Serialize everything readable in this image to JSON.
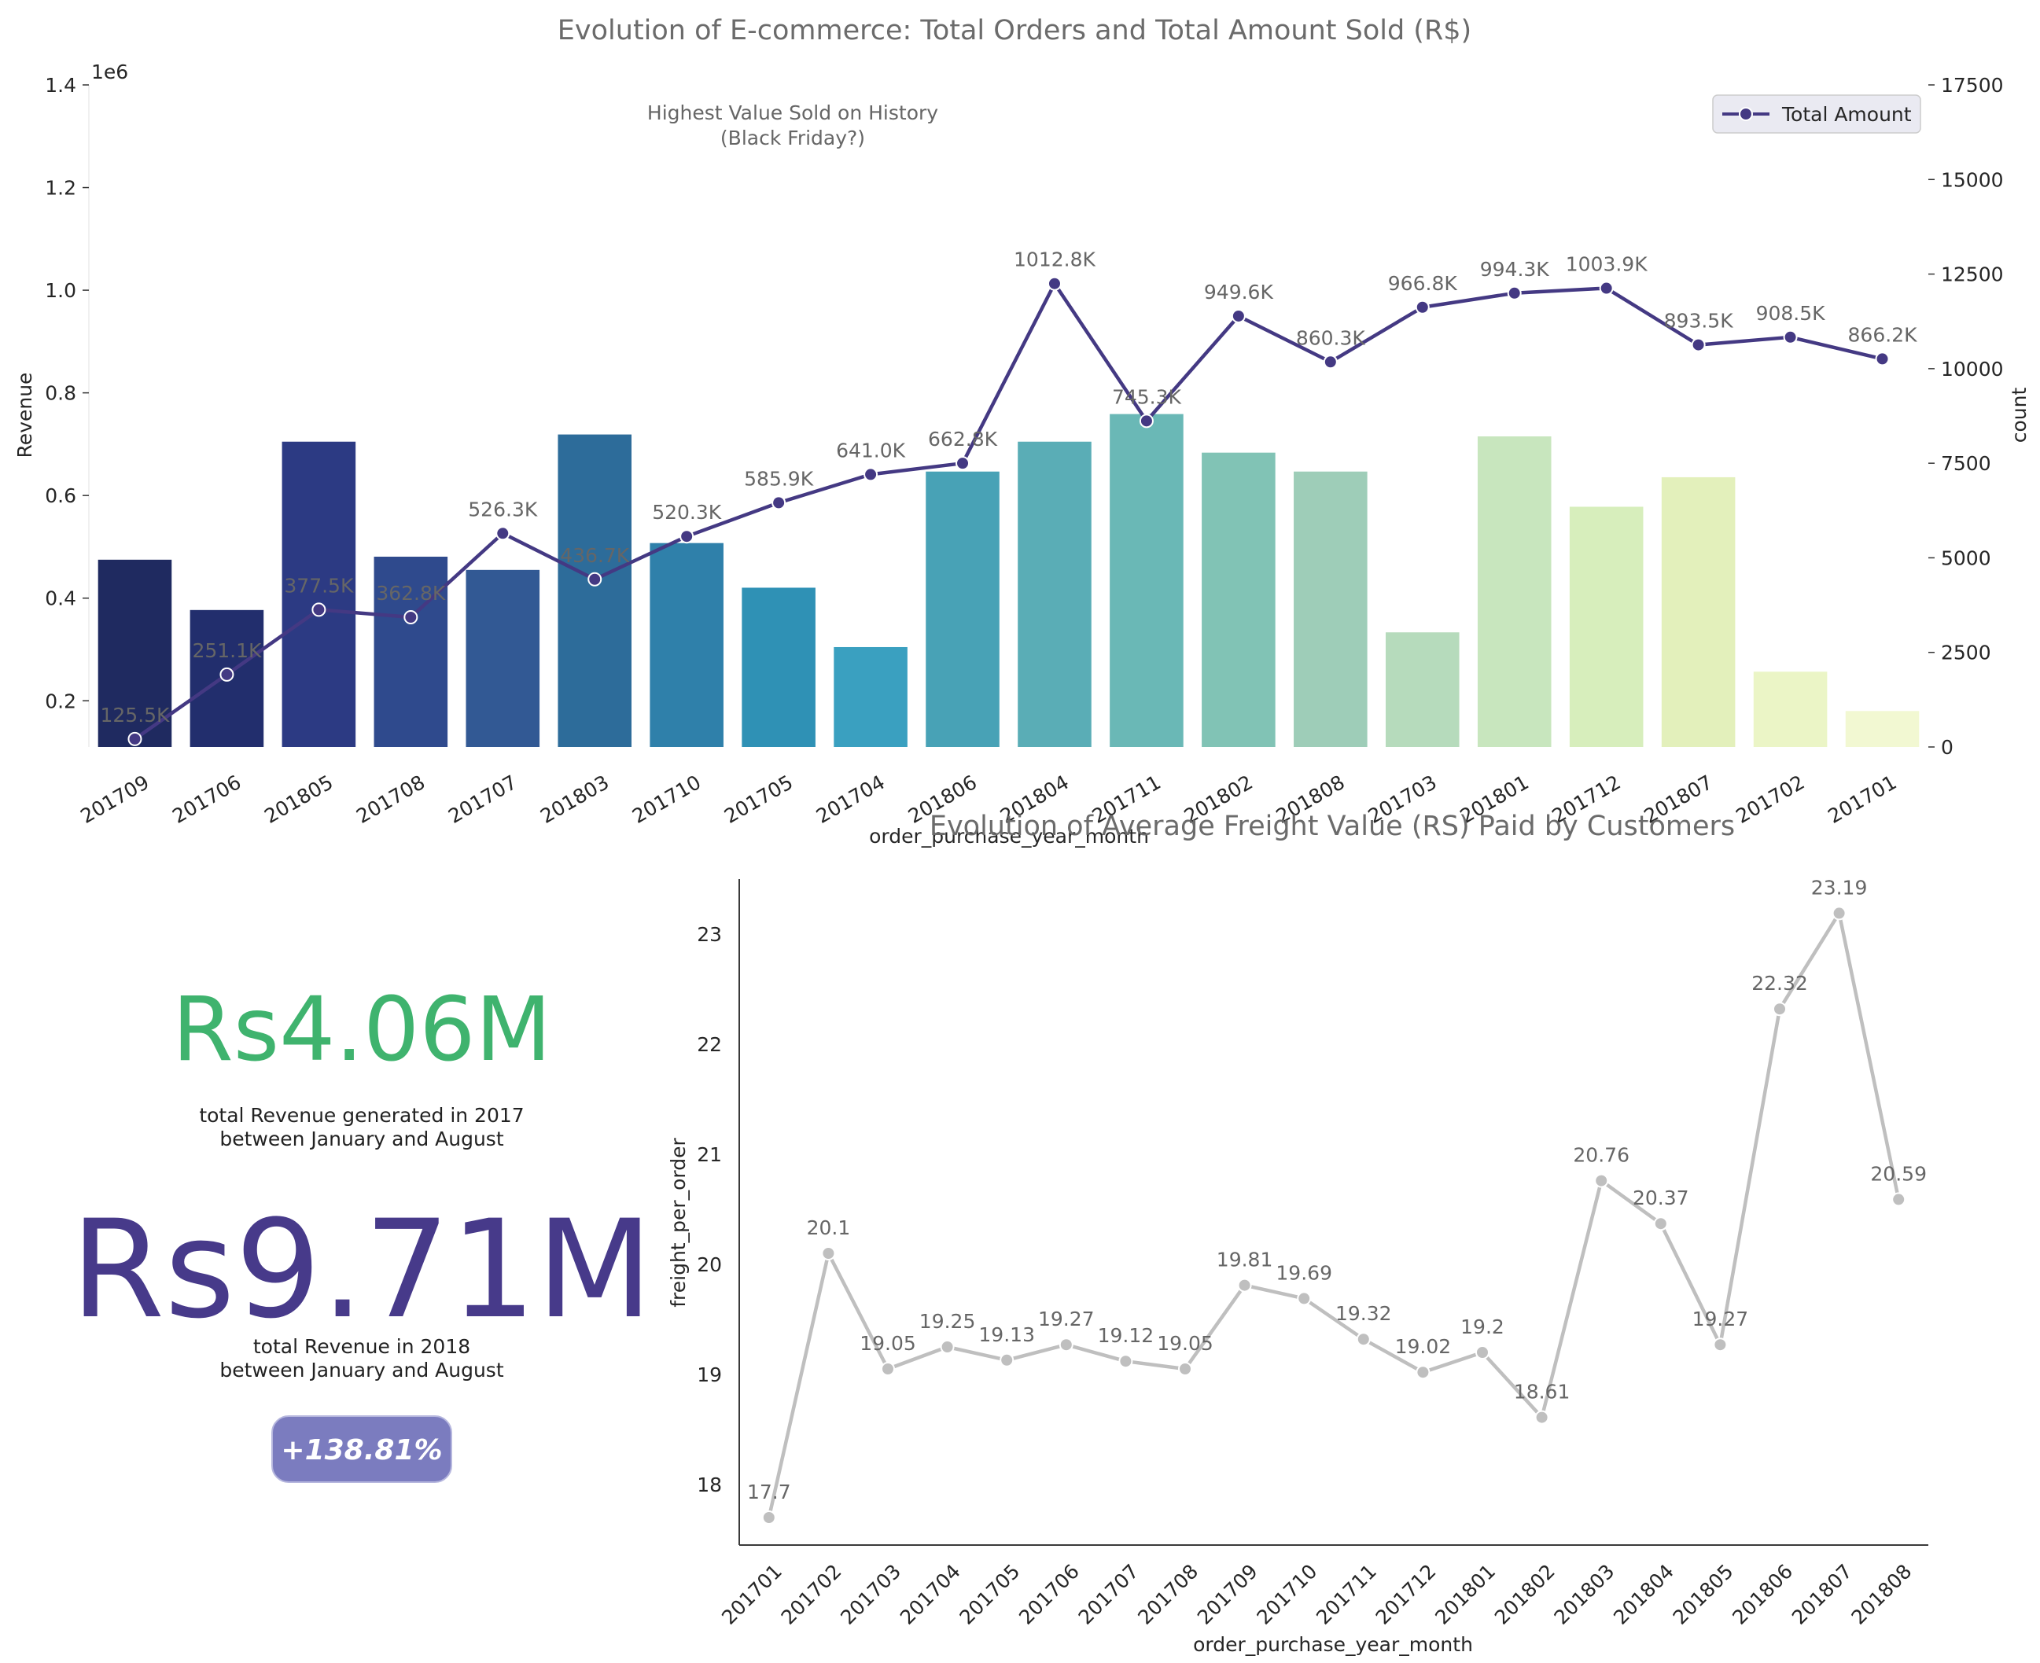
{
  "colors": {
    "line_main": "#443983",
    "freight_line": "#bfbfbf",
    "kpi_green": "#3fb36e",
    "kpi_purple": "#473a8a",
    "badge_bg": "#7b7cbf",
    "annotation_text": "#666666",
    "title_text": "#6b6b6b"
  },
  "chart_data": [
    {
      "type": "bar",
      "title": "Evolution of E-commerce: Total Orders and Total Amount Sold (R$)",
      "xlabel": "order_purchase_year_month",
      "ylabel": "Revenue",
      "y2label": "count",
      "y_multiplier": "1e6",
      "categories": [
        "201709",
        "201706",
        "201805",
        "201708",
        "201707",
        "201803",
        "201710",
        "201705",
        "201704",
        "201806",
        "201804",
        "201711",
        "201802",
        "201808",
        "201703",
        "201801",
        "201712",
        "201807",
        "201702",
        "201701"
      ],
      "bar_axis": "right",
      "bar_values": [
        4950,
        3620,
        8070,
        5030,
        4680,
        8260,
        5390,
        4210,
        2640,
        7280,
        8070,
        8800,
        7780,
        7280,
        3030,
        8210,
        6350,
        7130,
        1990,
        950
      ],
      "bar_colors": [
        "#1f2a60",
        "#222e6d",
        "#2c3a83",
        "#2f4a8d",
        "#325994",
        "#2d6c9a",
        "#2f80aa",
        "#2f91b5",
        "#3aa0c0",
        "#48a2b6",
        "#5aadb6",
        "#6ab8b6",
        "#81c3b5",
        "#9ecdb8",
        "#b6dbbc",
        "#c8e6be",
        "#d7eebc",
        "#e3f0bb",
        "#ebf5c6",
        "#f2f8d2"
      ],
      "left_ylim": [
        0.11,
        1.4
      ],
      "left_ticks": [
        0.2,
        0.4,
        0.6,
        0.8,
        1.0,
        1.2,
        1.4
      ],
      "left_tick_labels": [
        "0.2",
        "0.4",
        "0.6",
        "0.8",
        "1.0",
        "1.2",
        "1.4"
      ],
      "right_ylim": [
        0,
        17500
      ],
      "right_ticks": [
        0,
        2500,
        5000,
        7500,
        10000,
        12500,
        15000,
        17500
      ],
      "right_tick_labels": [
        "0",
        "2500",
        "5000",
        "7500",
        "10000",
        "12500",
        "15000",
        "17500"
      ],
      "series": [
        {
          "name": "Total Amount",
          "axis": "left",
          "values": [
            125500,
            251100,
            377500,
            362800,
            526300,
            436700,
            520300,
            585900,
            641000,
            662800,
            1012800,
            745300,
            949600,
            860300,
            966800,
            994300,
            1003900,
            893500,
            908500,
            866200
          ],
          "labels": [
            "125.5K",
            "251.1K",
            "377.5K",
            "362.8K",
            "526.3K",
            "436.7K",
            "520.3K",
            "585.9K",
            "641.0K",
            "662.8K",
            "1012.8K",
            "745.3K",
            "949.6K",
            "860.3K",
            "966.8K",
            "994.3K",
            "1003.9K",
            "893.5K",
            "908.5K",
            "866.2K"
          ]
        }
      ],
      "legend": "top-right",
      "grid": false,
      "annotation": [
        "Highest Value Sold on History",
        "(Black Friday?)"
      ]
    },
    {
      "type": "line",
      "title": "Evolution of Average Freight Value (RS) Paid by Customers",
      "xlabel": "order_purchase_year_month",
      "ylabel": "freight_per_order",
      "categories": [
        "201701",
        "201702",
        "201703",
        "201704",
        "201705",
        "201706",
        "201707",
        "201708",
        "201709",
        "201710",
        "201711",
        "201712",
        "201801",
        "201802",
        "201803",
        "201804",
        "201805",
        "201806",
        "201807",
        "201808"
      ],
      "values": [
        17.7,
        20.1,
        19.05,
        19.25,
        19.13,
        19.27,
        19.12,
        19.05,
        19.81,
        19.69,
        19.32,
        19.02,
        19.2,
        18.61,
        20.76,
        20.37,
        19.27,
        22.32,
        23.19,
        20.59
      ],
      "labels": [
        "17.7",
        "20.1",
        "19.05",
        "19.25",
        "19.13",
        "19.27",
        "19.12",
        "19.05",
        "19.81",
        "19.69",
        "19.32",
        "19.02",
        "19.2",
        "18.61",
        "20.76",
        "20.37",
        "19.27",
        "22.32",
        "23.19",
        "20.59"
      ],
      "ylim": [
        17.45,
        23.5
      ],
      "y_ticks": [
        18,
        19,
        20,
        21,
        22,
        23
      ],
      "y_tick_labels": [
        "18",
        "19",
        "20",
        "21",
        "22",
        "23"
      ],
      "grid": false
    }
  ],
  "kpis": {
    "rev_2017": "Rs4.06M",
    "rev_2017_caption1": "total Revenue generated in 2017",
    "rev_2017_caption2": "between January and August",
    "rev_2018": "Rs9.71M",
    "rev_2018_caption1": "total Revenue in 2018",
    "rev_2018_caption2": "between January and August",
    "growth_badge": "+138.81%"
  }
}
